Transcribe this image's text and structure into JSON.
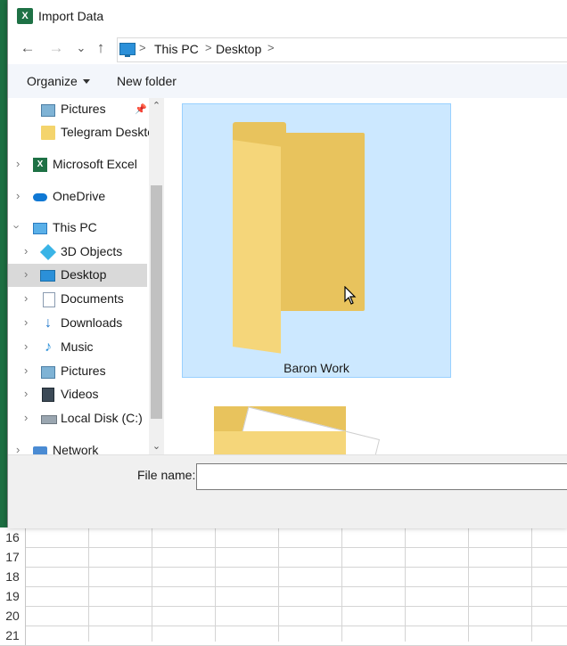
{
  "dialog": {
    "title": "Import Data",
    "title_icon_letter": "X"
  },
  "nav": {
    "back": "←",
    "forward": "→",
    "recent": "⌄",
    "up": "↑",
    "breadcrumbs": [
      "This PC",
      "Desktop"
    ],
    "sep": ">"
  },
  "commands": {
    "organize": "Organize",
    "new_folder": "New folder"
  },
  "sidebar": {
    "items": [
      {
        "label": "Pictures"
      },
      {
        "label": "Telegram Deskto"
      },
      {
        "label": "Microsoft Excel"
      },
      {
        "label": "OneDrive"
      },
      {
        "label": "This PC"
      },
      {
        "label": "3D Objects"
      },
      {
        "label": "Desktop"
      },
      {
        "label": "Documents"
      },
      {
        "label": "Downloads"
      },
      {
        "label": "Music"
      },
      {
        "label": "Pictures"
      },
      {
        "label": "Videos"
      },
      {
        "label": "Local Disk (C:)"
      },
      {
        "label": "Network"
      }
    ]
  },
  "content": {
    "items": [
      {
        "label": "Baron Work",
        "selected": true
      }
    ]
  },
  "filename": {
    "label": "File name:",
    "value": ""
  },
  "spreadsheet": {
    "rows": [
      "16",
      "17",
      "18",
      "19",
      "20",
      "21"
    ]
  },
  "colors": {
    "accent": "#cce8ff",
    "folder": "#e8c35d",
    "excel_green": "#1e7145"
  }
}
